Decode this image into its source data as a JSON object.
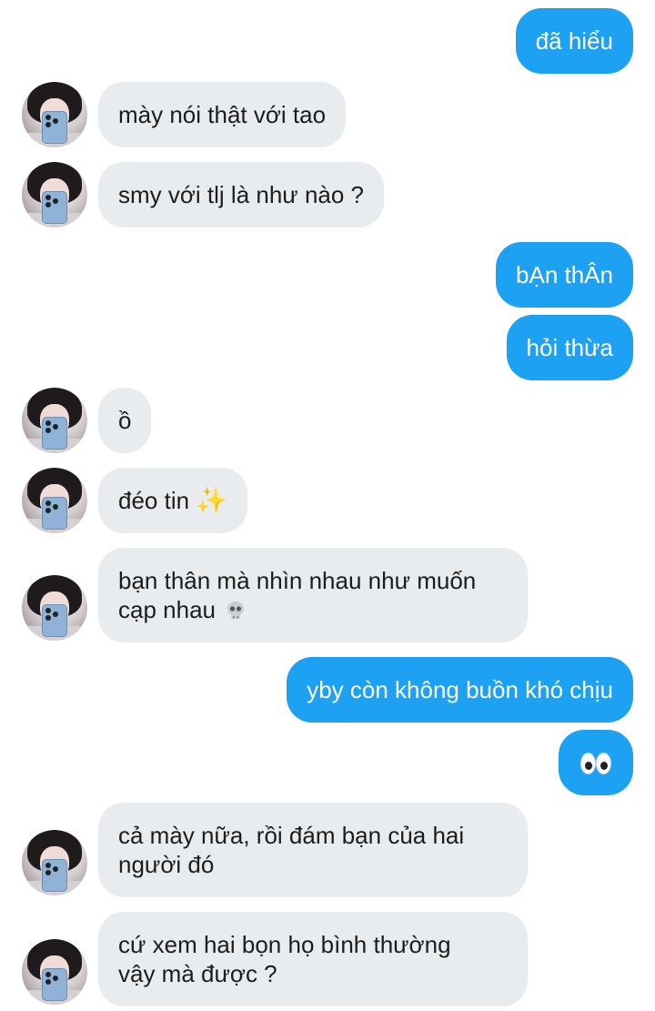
{
  "conversation": {
    "messages": [
      {
        "id": "m1",
        "side": "out",
        "text": "đã hiểu"
      },
      {
        "id": "m2",
        "side": "in",
        "text": "mày nói thật với tao"
      },
      {
        "id": "m3",
        "side": "in",
        "text": "smy với tlj là như nào ?"
      },
      {
        "id": "m4",
        "side": "out",
        "text": "bẠn thÂn"
      },
      {
        "id": "m5",
        "side": "out",
        "text": "hỏi thừa"
      },
      {
        "id": "m6",
        "side": "in",
        "text": "ồ"
      },
      {
        "id": "m7",
        "side": "in",
        "text": "đéo tin",
        "emoji": "sparkles-emoji"
      },
      {
        "id": "m8",
        "side": "in",
        "line1": "bạn thân mà nhìn nhau như muốn",
        "line2": "cạp nhau",
        "emoji": "skull-emoji"
      },
      {
        "id": "m9",
        "side": "out",
        "text": "yby còn không buồn khó chịu"
      },
      {
        "id": "m10",
        "side": "out",
        "text": "",
        "emoji": "eyes-emoji"
      },
      {
        "id": "m11",
        "side": "in",
        "line1": "cả mày nữa, rồi đám bạn của hai",
        "line2": "người đó"
      },
      {
        "id": "m12",
        "side": "in",
        "line1": "cứ xem hai bọn họ bình thường",
        "line2": "vậy mà được ?"
      }
    ],
    "sparkle_glyph": "✨",
    "colors": {
      "outgoing_bubble": "#1da1f2",
      "incoming_bubble": "#e9ecef",
      "outgoing_text": "#ffffff",
      "incoming_text": "#1c1c1c"
    }
  }
}
